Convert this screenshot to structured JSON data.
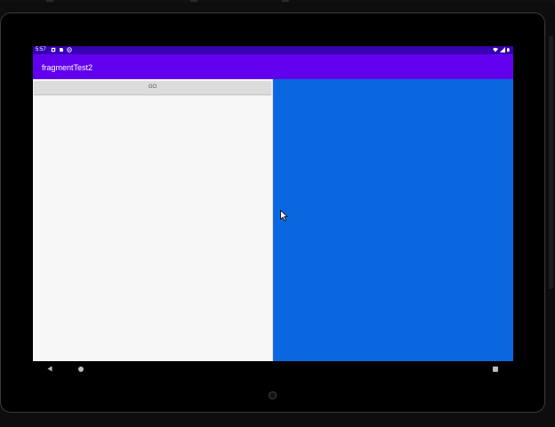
{
  "status_bar": {
    "time": "5:57"
  },
  "app_bar": {
    "title": "fragmentTest2"
  },
  "left_fragment": {
    "button_label": "GO"
  },
  "right_fragment": {
    "background_color": "#0b67e0"
  },
  "theme": {
    "primary": "#6200ee",
    "primary_dark": "#3700b3"
  },
  "navigation": {
    "back_icon": "back-icon",
    "home_icon": "home-icon",
    "recents_icon": "recents-icon"
  }
}
